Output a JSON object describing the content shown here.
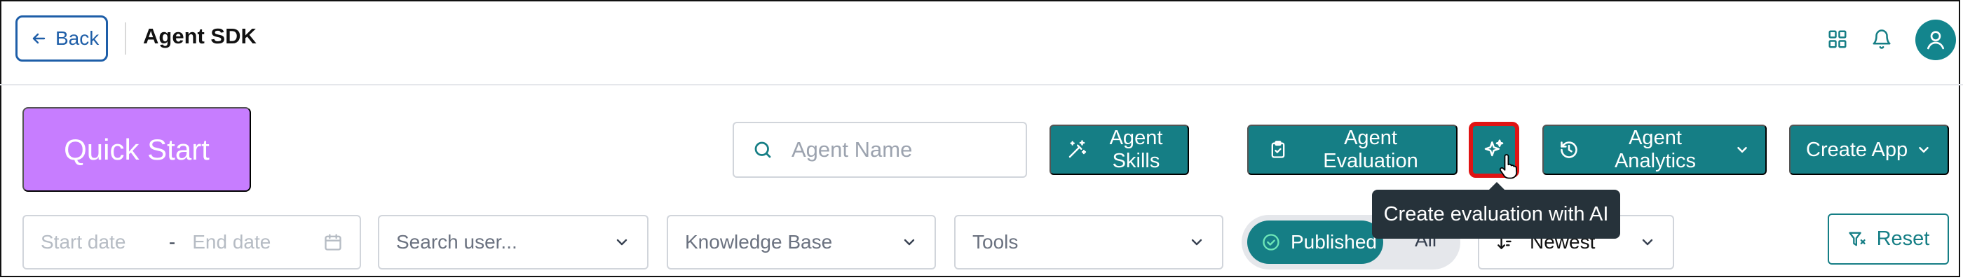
{
  "header": {
    "back_label": "Back",
    "title": "Agent SDK",
    "icons": [
      "grid-icon",
      "bell-icon",
      "user-icon"
    ]
  },
  "toolbar": {
    "quick_start_label": "Quick Start",
    "search_placeholder": "Agent Name",
    "agent_skills_label": "Agent Skills",
    "agent_evaluation_label": "Agent Evaluation",
    "agent_analytics_label": "Agent Analytics",
    "create_app_label": "Create App",
    "ai_button_tooltip": "Create evaluation with AI"
  },
  "filters": {
    "start_date_placeholder": "Start date",
    "date_separator": "-",
    "end_date_placeholder": "End date",
    "search_user_placeholder": "Search user...",
    "knowledge_base_placeholder": "Knowledge Base",
    "tools_placeholder": "Tools",
    "status_toggle": {
      "selected": "Published",
      "other": "All"
    },
    "sort_selected": "Newest",
    "reset_label": "Reset"
  },
  "colors": {
    "primary_teal": "#157e85",
    "quick_start_purple": "#c77dff",
    "back_blue": "#1e5ea8",
    "highlight_red": "#e01414",
    "tooltip_bg": "#26323a"
  }
}
